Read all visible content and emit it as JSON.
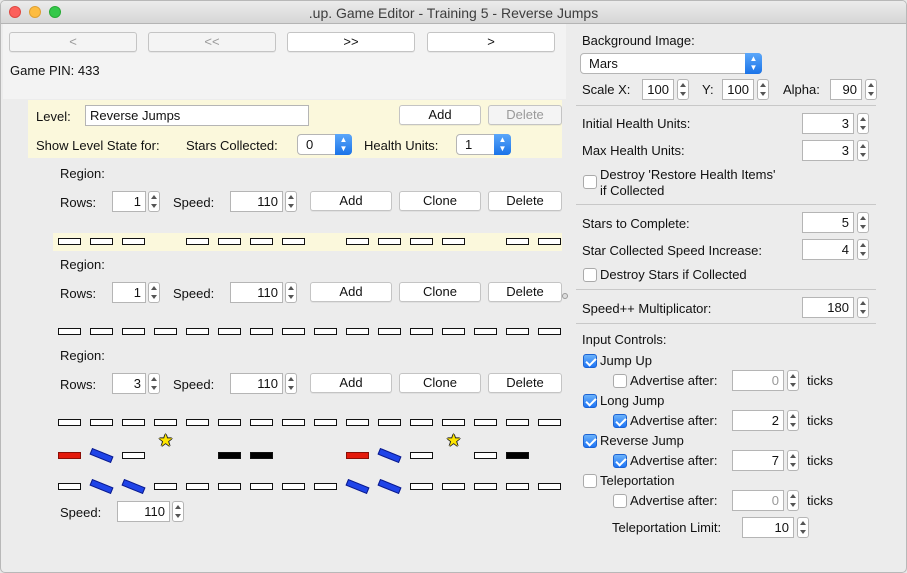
{
  "window": {
    "title": ".up. Game Editor - Training 5 - Reverse Jumps"
  },
  "nav": {
    "prev": "<",
    "first": "<<",
    "last": ">>",
    "next": ">"
  },
  "game_pin": "Game PIN: 433",
  "level": {
    "label": "Level:",
    "name": "Reverse Jumps",
    "add": "Add",
    "delete": "Delete",
    "show_state_label": "Show Level State for:",
    "stars_label": "Stars Collected:",
    "stars_value": "0",
    "health_label": "Health Units:",
    "health_value": "1"
  },
  "regions": [
    {
      "label": "Region:",
      "rows_label": "Rows:",
      "rows": "1",
      "speed_label": "Speed:",
      "speed": "110",
      "add": "Add",
      "clone": "Clone",
      "delete": "Delete"
    },
    {
      "label": "Region:",
      "rows_label": "Rows:",
      "rows": "1",
      "speed_label": "Speed:",
      "speed": "110",
      "add": "Add",
      "clone": "Clone",
      "delete": "Delete"
    },
    {
      "label": "Region:",
      "rows_label": "Rows:",
      "rows": "3",
      "speed_label": "Speed:",
      "speed": "110",
      "add": "Add",
      "clone": "Clone",
      "delete": "Delete"
    }
  ],
  "bottom_speed": {
    "label": "Speed:",
    "value": "110"
  },
  "right": {
    "bg_label": "Background Image:",
    "bg_value": "Mars",
    "scale_x_label": "Scale X:",
    "scale_x": "100",
    "y_label": "Y:",
    "y": "100",
    "alpha_label": "Alpha:",
    "alpha": "90",
    "initial_health_label": "Initial Health Units:",
    "initial_health": "3",
    "max_health_label": "Max Health Units:",
    "max_health": "3",
    "destroy_restore_label_1": "Destroy 'Restore Health Items'",
    "destroy_restore_label_2": "if Collected",
    "stars_complete_label": "Stars to Complete:",
    "stars_complete": "5",
    "star_speed_label": "Star Collected Speed Increase:",
    "star_speed": "4",
    "destroy_stars_label": "Destroy Stars if Collected",
    "speed_mult_label": "Speed++ Multiplicator:",
    "speed_mult": "180",
    "input_controls_label": "Input Controls:",
    "controls": [
      {
        "name": "Jump Up",
        "checked": true,
        "advertise_label": "Advertise after:",
        "advertise_checked": false,
        "value": "0",
        "ticks": "ticks"
      },
      {
        "name": "Long Jump",
        "checked": true,
        "advertise_label": "Advertise after:",
        "advertise_checked": true,
        "value": "2",
        "ticks": "ticks"
      },
      {
        "name": "Reverse Jump",
        "checked": true,
        "advertise_label": "Advertise after:",
        "advertise_checked": true,
        "value": "7",
        "ticks": "ticks"
      },
      {
        "name": "Teleportation",
        "checked": false,
        "advertise_label": "Advertise after:",
        "advertise_checked": false,
        "value": "0",
        "ticks": "ticks"
      }
    ],
    "teleport_limit_label": "Teleportation Limit:",
    "teleport_limit": "10"
  },
  "colors": {
    "highlight_bg": "#fbf8dc",
    "accent": "#1d74f5",
    "tile_red": "#e31a0c",
    "tile_blue": "#1f44e8",
    "tile_black": "#000000",
    "star": "#ffe600"
  },
  "icons": {
    "star": "★"
  }
}
